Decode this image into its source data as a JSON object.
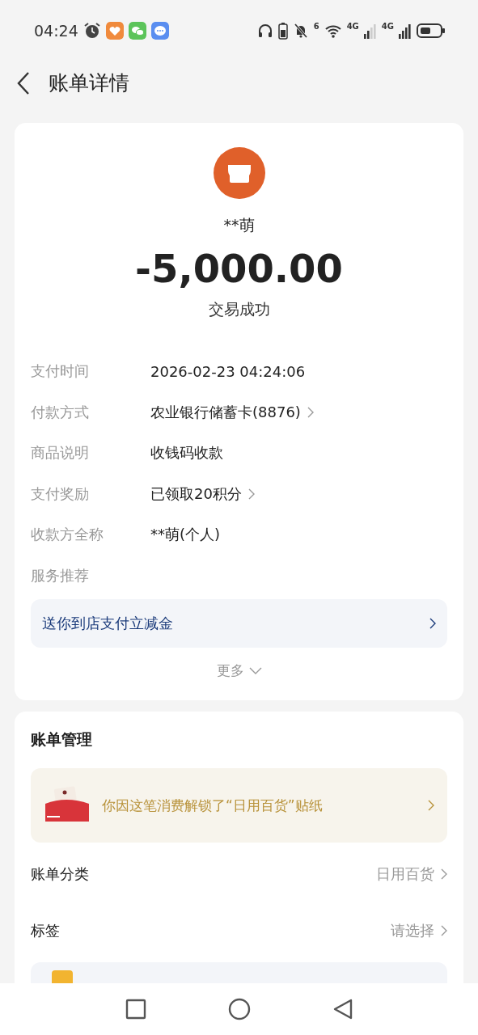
{
  "status_bar": {
    "time": "04:24",
    "wifi_badge": "6",
    "signal_labels": [
      "4G",
      "4G"
    ]
  },
  "header": {
    "title": "账单详情"
  },
  "summary": {
    "merchant": "**萌",
    "amount": "-5,000.00",
    "status": "交易成功"
  },
  "details": [
    {
      "label": "支付时间",
      "value": "2026-02-23 04:24:06",
      "has_arrow": false
    },
    {
      "label": "付款方式",
      "value": "农业银行储蓄卡(8876)",
      "has_arrow": true
    },
    {
      "label": "商品说明",
      "value": "收钱码收款",
      "has_arrow": false
    },
    {
      "label": "支付奖励",
      "value": "已领取20积分",
      "has_arrow": true
    },
    {
      "label": "收款方全称",
      "value": "**萌(个人)",
      "has_arrow": false
    },
    {
      "label": "服务推荐",
      "has_arrow": false
    }
  ],
  "promo": {
    "text": "送你到店支付立减金"
  },
  "more": {
    "label": "更多"
  },
  "management": {
    "title": "账单管理",
    "sticker_banner": {
      "text": "你因这笔消费解锁了“日用百货”贴纸"
    },
    "rows": [
      {
        "label": "账单分类",
        "value": "日用百货"
      },
      {
        "label": "标签",
        "value": "请选择"
      }
    ]
  }
}
